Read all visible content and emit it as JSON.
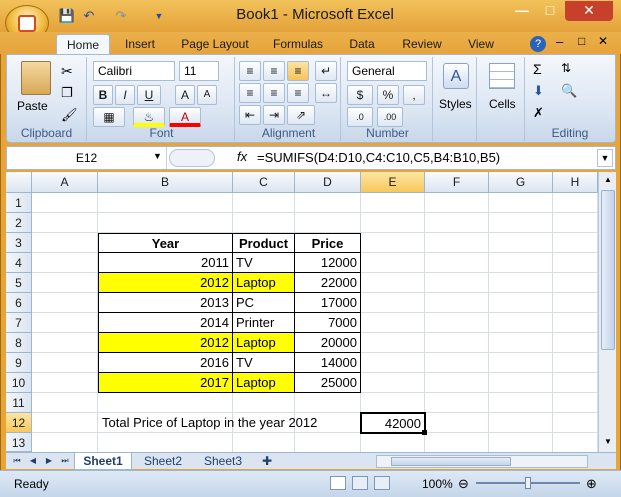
{
  "window": {
    "title": "Book1 - Microsoft Excel"
  },
  "ribbon_tabs": [
    "Home",
    "Insert",
    "Page Layout",
    "Formulas",
    "Data",
    "Review",
    "View"
  ],
  "font": {
    "name": "Calibri",
    "size": "11"
  },
  "number_format": "General",
  "groups": {
    "clipboard": "Clipboard",
    "font": "Font",
    "alignment": "Alignment",
    "number": "Number",
    "editing": "Editing",
    "paste": "Paste",
    "styles": "Styles",
    "cells": "Cells"
  },
  "name_box": "E12",
  "formula": "=SUMIFS(D4:D10,C4:C10,C5,B4:B10,B5)",
  "columns": [
    "A",
    "B",
    "C",
    "D",
    "E",
    "F",
    "G",
    "H"
  ],
  "rows": [
    "1",
    "2",
    "3",
    "4",
    "5",
    "6",
    "7",
    "8",
    "9",
    "10",
    "11",
    "12",
    "13"
  ],
  "table": {
    "headers": [
      "Year",
      "Product",
      "Price"
    ],
    "rows": [
      {
        "year": "2011",
        "product": "TV",
        "price": "12000",
        "highlight": false
      },
      {
        "year": "2012",
        "product": "Laptop",
        "price": "22000",
        "highlight": true
      },
      {
        "year": "2013",
        "product": "PC",
        "price": "17000",
        "highlight": false
      },
      {
        "year": "2014",
        "product": "Printer",
        "price": "7000",
        "highlight": false
      },
      {
        "year": "2012",
        "product": "Laptop",
        "price": "20000",
        "highlight": true
      },
      {
        "year": "2016",
        "product": "TV",
        "price": "14000",
        "highlight": false
      },
      {
        "year": "2017",
        "product": "Laptop",
        "price": "25000",
        "highlight": true
      }
    ]
  },
  "summary": {
    "label": "Total Price of Laptop in the year 2012",
    "value": "42000"
  },
  "sheet_tabs": [
    "Sheet1",
    "Sheet2",
    "Sheet3"
  ],
  "status": {
    "ready": "Ready",
    "zoom": "100%"
  },
  "colors": {
    "highlight": "#ffff00",
    "accent": "#e8a437"
  }
}
